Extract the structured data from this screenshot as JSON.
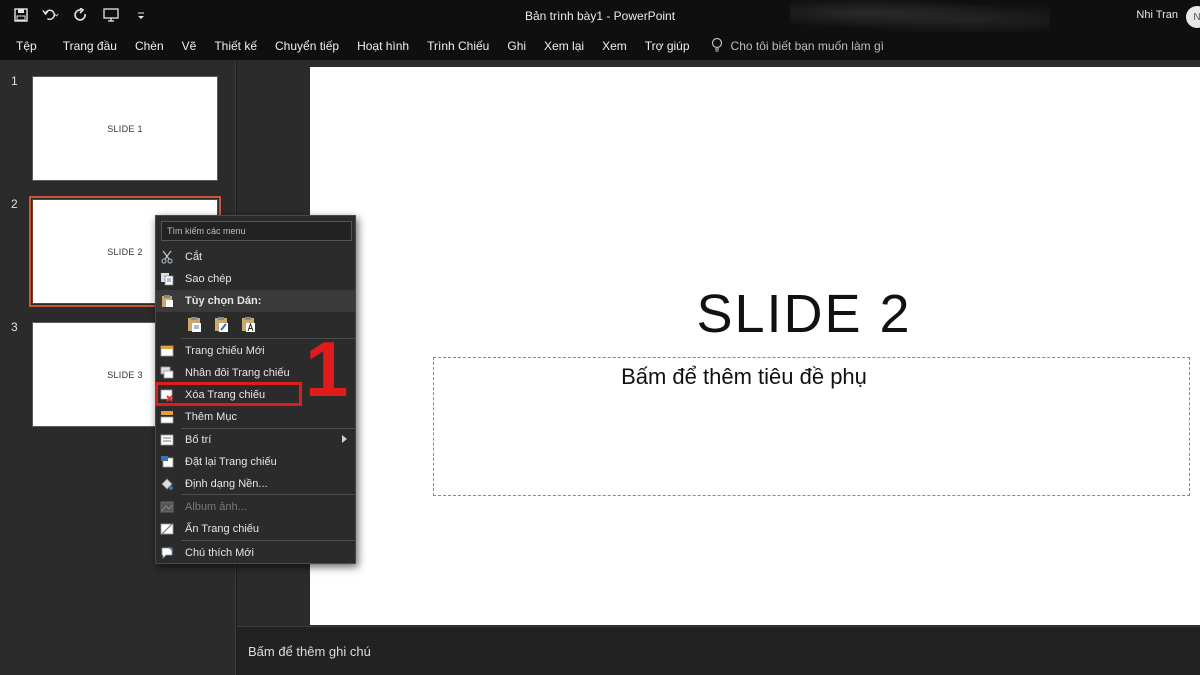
{
  "titlebar": {
    "window_title": "Bản trình bày1  -  PowerPoint",
    "user_name": "Nhi Tran",
    "user_initial": "N",
    "qat_icons": [
      "save-icon",
      "undo-icon",
      "redo-icon",
      "present-icon",
      "customize-icon"
    ]
  },
  "ribbon": {
    "tabs": [
      "Tệp",
      "Trang đầu",
      "Chèn",
      "Vẽ",
      "Thiết kế",
      "Chuyển tiếp",
      "Hoạt hình",
      "Trình Chiếu",
      "Ghi",
      "Xem lại",
      "Xem",
      "Trợ giúp"
    ],
    "tell_me": "Cho tôi biết bạn muốn làm gì"
  },
  "slides": [
    {
      "number": "1",
      "label": "SLIDE 1"
    },
    {
      "number": "2",
      "label": "SLIDE 2"
    },
    {
      "number": "3",
      "label": "SLIDE 3"
    }
  ],
  "editor": {
    "title": "SLIDE 2",
    "subtitle": "Bấm để thêm tiêu đề phụ"
  },
  "notes": {
    "placeholder": "Bấm để thêm ghi chú"
  },
  "context_menu": {
    "search_placeholder": "Tìm kiếm các menu",
    "cut": "Cắt",
    "copy": "Sao chép",
    "paste_options": "Tùy chọn Dán:",
    "new_slide": "Trang chiếu Mới",
    "duplicate_slide": "Nhân đôi Trang chiếu",
    "delete_slide": "Xóa Trang chiếu",
    "add_section": "Thêm Mục",
    "layout": "Bố trí",
    "reset_slide": "Đặt lại Trang chiếu",
    "format_background": "Định dạng Nền...",
    "photo_album": "Album ảnh...",
    "hide_slide": "Ẩn Trang chiếu",
    "new_comment": "Chú thích Mới"
  },
  "annotation": {
    "step_number": "1",
    "color": "#e01b1b"
  },
  "colors": {
    "background": "#1f1f1f",
    "pane": "#2b2b2b",
    "titlebar": "#0f0f0f",
    "selected_thumb": "#c55a3a"
  }
}
